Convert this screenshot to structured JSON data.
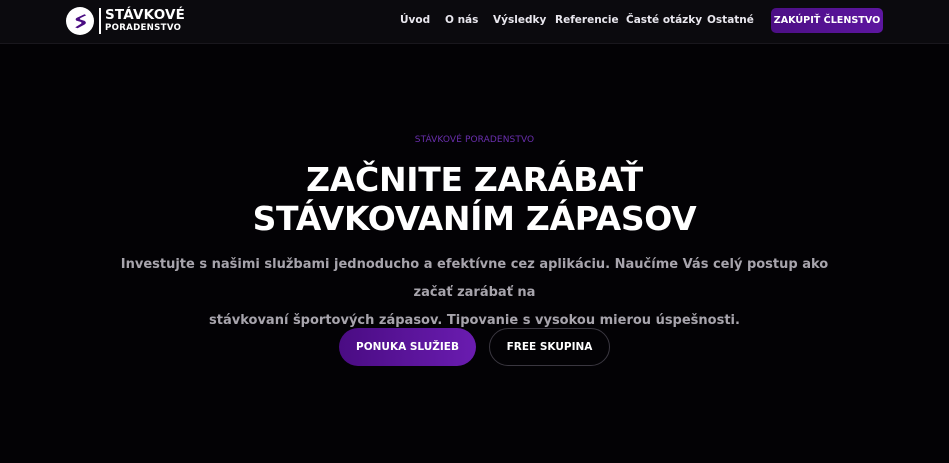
{
  "header": {
    "logo": {
      "line1": "STÁVKOVÉ",
      "line2": "PORADENSTVO",
      "icon": "s-logo-icon"
    },
    "nav": [
      {
        "label": "Úvod"
      },
      {
        "label": "O nás"
      },
      {
        "label": "Výsledky"
      },
      {
        "label": "Referencie"
      },
      {
        "label": "Časté otázky"
      },
      {
        "label": "Ostatné"
      }
    ],
    "cta_label": "ZAKÚPIŤ ČLENSTVO"
  },
  "hero": {
    "eyebrow": "STÁVKOVÉ PORADENSTVO",
    "headline_line1": "ZAČNITE ZARÁBAŤ",
    "headline_line2": "STÁVKOVANÍM ZÁPASOV",
    "subtext_line1": "Investujte s našimi službami jednoducho a efektívne cez aplikáciu. Naučíme Vás celý postup ako začať zarábať na",
    "subtext_line2": "stávkovaní športových zápasov. Tipovanie s vysokou mierou úspešnosti.",
    "primary_button": "PONUKA SLUŽIEB",
    "secondary_button": "FREE SKUPINA"
  },
  "colors": {
    "background": "#030205",
    "header_background": "#0b0a0e",
    "accent_purple": "#5d16a0",
    "eyebrow_purple": "#6a2fae",
    "subtext_gray": "#a7a4ac"
  }
}
